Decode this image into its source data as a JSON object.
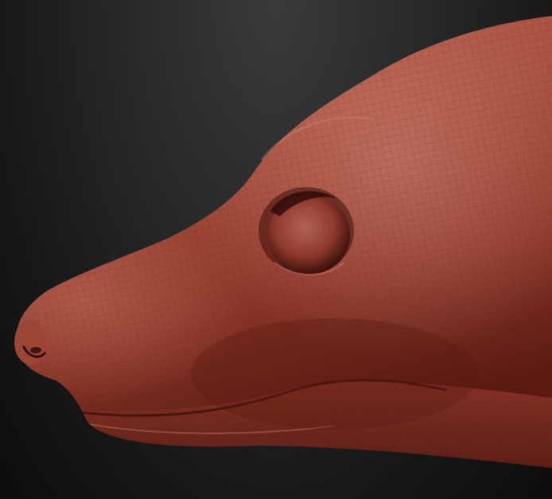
{
  "scene": {
    "subject": "sculpted-animal-head",
    "material_colors": {
      "base": "#8e3a2c",
      "highlight": "#c0705f",
      "shadow": "#4a1610",
      "wire": "#6b2418"
    },
    "background_colors": {
      "top": "#3a3a3a",
      "bottom": "#0d0d0d"
    }
  }
}
